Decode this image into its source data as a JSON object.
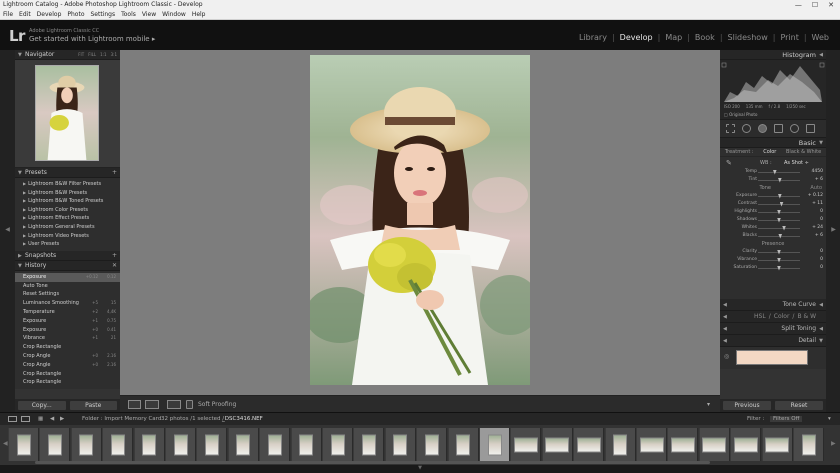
{
  "window": {
    "title": "Lightroom Catalog - Adobe Photoshop Lightroom Classic - Develop",
    "controls": [
      "—",
      "☐",
      "✕"
    ]
  },
  "menu": [
    "File",
    "Edit",
    "Develop",
    "Photo",
    "Settings",
    "Tools",
    "View",
    "Window",
    "Help"
  ],
  "identity": {
    "logo": "Lr",
    "product": "Adobe Lightroom Classic CC",
    "tagline": "Get started with Lightroom mobile  ▸"
  },
  "modules": [
    {
      "label": "Library",
      "active": false
    },
    {
      "label": "Develop",
      "active": true
    },
    {
      "label": "Map",
      "active": false
    },
    {
      "label": "Book",
      "active": false
    },
    {
      "label": "Slideshow",
      "active": false
    },
    {
      "label": "Print",
      "active": false
    },
    {
      "label": "Web",
      "active": false
    }
  ],
  "left": {
    "navigator": {
      "title": "Navigator",
      "options": [
        "FIT",
        "FILL",
        "1:1",
        "3:1"
      ]
    },
    "presets": {
      "title": "Presets",
      "items": [
        "Lightroom B&W Filter Presets",
        "Lightroom B&W Presets",
        "Lightroom B&W Toned Presets",
        "Lightroom Color Presets",
        "Lightroom Effect Presets",
        "Lightroom General Presets",
        "Lightroom Video Presets",
        "User Presets"
      ]
    },
    "snapshots": {
      "title": "Snapshots"
    },
    "history": {
      "title": "History",
      "items": [
        {
          "label": "Exposure",
          "v1": "+0.12",
          "v2": "0.12",
          "selected": true
        },
        {
          "label": "Auto Tone",
          "v1": "",
          "v2": "",
          "selected": false
        },
        {
          "label": "Reset Settings",
          "v1": "",
          "v2": "",
          "selected": false
        },
        {
          "label": "Luminance Smoothing",
          "v1": "+5",
          "v2": "15",
          "selected": false
        },
        {
          "label": "Temperature",
          "v1": "+2",
          "v2": "4,4K",
          "selected": false
        },
        {
          "label": "Exposure",
          "v1": "+1",
          "v2": "0.75",
          "selected": false
        },
        {
          "label": "Exposure",
          "v1": "+0",
          "v2": "0.41",
          "selected": false
        },
        {
          "label": "Vibrance",
          "v1": "+1",
          "v2": "21",
          "selected": false
        },
        {
          "label": "Crop Rectangle",
          "v1": "",
          "v2": "",
          "selected": false
        },
        {
          "label": "Crop Angle",
          "v1": "+0",
          "v2": "2.16",
          "selected": false
        },
        {
          "label": "Crop Angle",
          "v1": "+0",
          "v2": "2.16",
          "selected": false
        },
        {
          "label": "Crop Rectangle",
          "v1": "",
          "v2": "",
          "selected": false
        },
        {
          "label": "Crop Rectangle",
          "v1": "",
          "v2": "",
          "selected": false
        }
      ]
    },
    "buttons": {
      "copy": "Copy...",
      "paste": "Paste"
    }
  },
  "toolbar": {
    "soft_proofing": "Soft Proofing"
  },
  "right": {
    "histogram": {
      "title": "Histogram",
      "readout": [
        "ISO 200",
        "135 mm",
        "f / 2.8",
        "1/250 sec"
      ],
      "original_photo": "Original Photo"
    },
    "basic": {
      "title": "Basic",
      "treatment_label": "Treatment :",
      "treatment_color": "Color",
      "treatment_bw": "Black & White",
      "wb_label": "WB :",
      "wb_value": "As Shot ÷",
      "wb_sliders": [
        {
          "label": "Temp",
          "value": "4450",
          "pos": 0.4
        },
        {
          "label": "Tint",
          "value": "+ 6",
          "pos": 0.52
        }
      ],
      "tone_label": "Tone",
      "tone_auto": "Auto",
      "tone_sliders": [
        {
          "label": "Exposure",
          "value": "+ 0.12",
          "pos": 0.52
        },
        {
          "label": "Contrast",
          "value": "+ 11",
          "pos": 0.56
        },
        {
          "label": "Highlights",
          "value": "0",
          "pos": 0.5
        },
        {
          "label": "Shadows",
          "value": "0",
          "pos": 0.5
        },
        {
          "label": "Whites",
          "value": "+ 24",
          "pos": 0.62
        },
        {
          "label": "Blacks",
          "value": "+ 6",
          "pos": 0.53
        }
      ],
      "presence_label": "Presence",
      "presence_sliders": [
        {
          "label": "Clarity",
          "value": "0",
          "pos": 0.5
        },
        {
          "label": "Vibrance",
          "value": "0",
          "pos": 0.5
        },
        {
          "label": "Saturation",
          "value": "0",
          "pos": 0.5
        }
      ]
    },
    "tone_curve": "Tone Curve",
    "hsl": {
      "hsl": "HSL",
      "color": "Color",
      "bw": "B & W"
    },
    "split_toning": "Split Toning",
    "detail": "Detail",
    "buttons": {
      "previous": "Previous",
      "reset": "Reset"
    }
  },
  "filmstrip": {
    "source": "Folder : Import Memory Card",
    "count": "32 photos /1 selected /",
    "filename": "_DSC3416.NEF",
    "filter_label": "Filter :",
    "filter_value": "Filters Off"
  },
  "colors": {
    "accent_bg": "#7d7d7d",
    "panel": "#333333",
    "skin_swatch": "#f3d8c4"
  }
}
